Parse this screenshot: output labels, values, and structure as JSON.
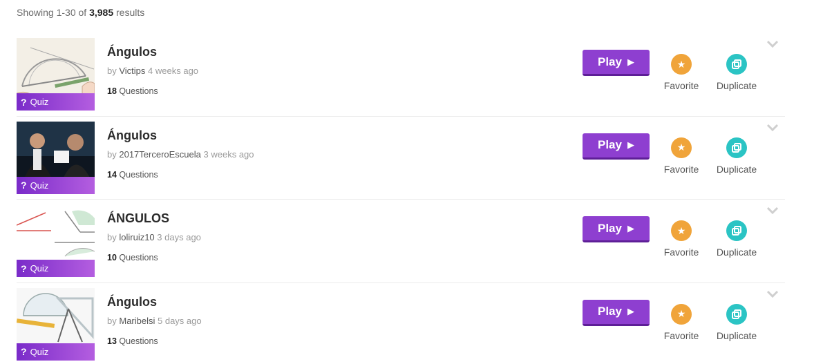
{
  "results": {
    "prefix": "Showing 1-30 of",
    "total": "3,985",
    "suffix": "results"
  },
  "badge_label": "Quiz",
  "badge_mark": "?",
  "play_label": "Play",
  "favorite_label": "Favorite",
  "duplicate_label": "Duplicate",
  "questions_word": "Questions",
  "by_word": "by",
  "colors": {
    "play_button": "#8e3fd0",
    "favorite": "#f0a43a",
    "duplicate": "#2bc4c4",
    "quiz_badge": "#7a2bc9"
  },
  "items": [
    {
      "title": "Ángulos",
      "author": "Victips",
      "time": "4 weeks ago",
      "question_count": "18"
    },
    {
      "title": "Ángulos",
      "author": "2017TerceroEscuela",
      "time": "3 weeks ago",
      "question_count": "14"
    },
    {
      "title": "ÁNGULOS",
      "author": "loliruiz10",
      "time": "3 days ago",
      "question_count": "10"
    },
    {
      "title": "Ángulos",
      "author": "Maribelsi",
      "time": "5 days ago",
      "question_count": "13"
    }
  ]
}
